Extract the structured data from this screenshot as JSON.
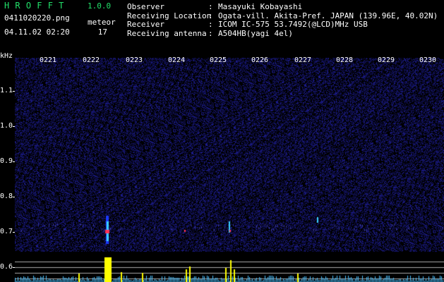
{
  "header": {
    "app_title": "HROFFT",
    "app_version": "1.0.0",
    "filename": "0411020220.png",
    "datetime": "04.11.02 02:20",
    "meteor_label": "meteor",
    "meteor_count": "17"
  },
  "meta": [
    {
      "key": "Observer",
      "sep": ":",
      "value": "Masayuki Kobayashi"
    },
    {
      "key": "Receiving Location",
      "sep": ":",
      "value": "Ogata-vill. Akita-Pref. JAPAN (139.96E, 40.02N)"
    },
    {
      "key": "Receiver",
      "sep": ":",
      "value": "ICOM IC-575 53.7492(@LCD)MHz USB"
    },
    {
      "key": "Receiving antenna",
      "sep": ":",
      "value": "A504HB(yagi 4el)"
    }
  ],
  "axis": {
    "unit": "kHz",
    "y_labels": [
      "1.1",
      "1.0",
      "0.9",
      "0.8",
      "0.7",
      "0.6"
    ],
    "x_labels": [
      "0221",
      "0222",
      "0223",
      "0224",
      "0225",
      "0226",
      "0227",
      "0228",
      "0229",
      "0230"
    ]
  },
  "colors": {
    "background": "#000000",
    "noise": "#1a1a66",
    "title": "#22e06a",
    "text": "#ffffff",
    "meteor_cyan": "#3ad0ff",
    "meteor_core": "#ff3355",
    "bars": "#ffff00"
  }
}
